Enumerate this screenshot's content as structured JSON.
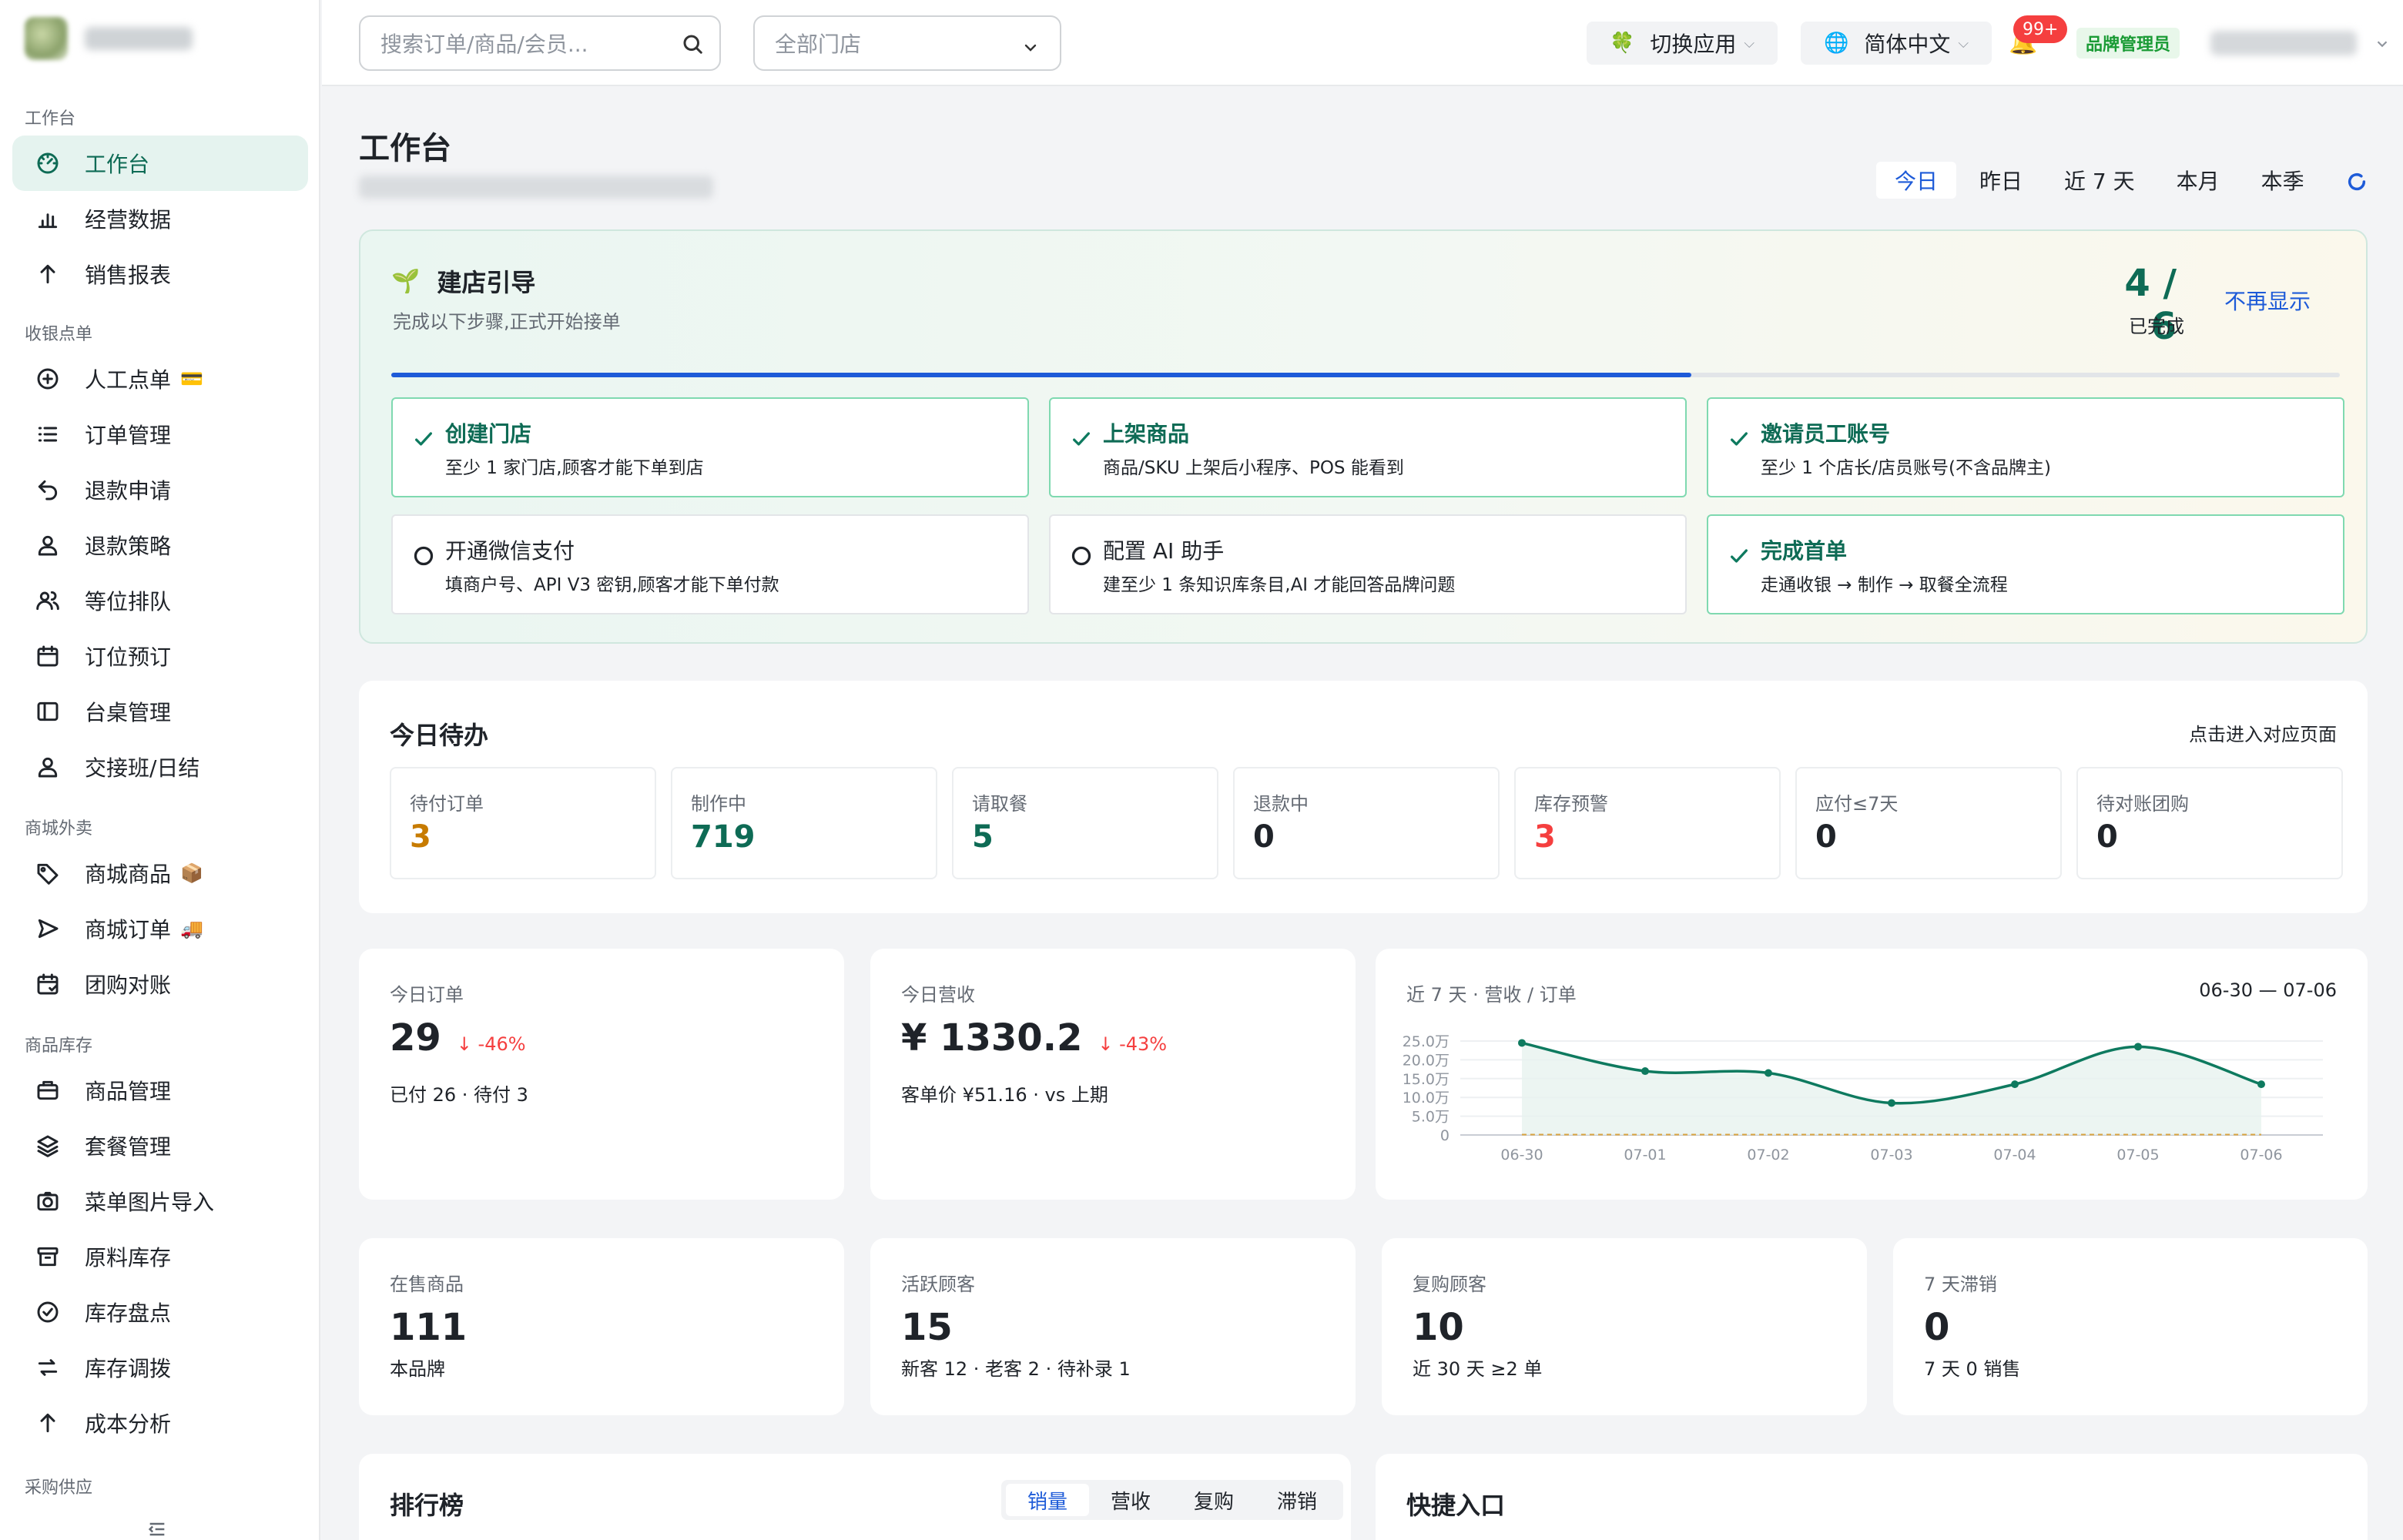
{
  "sidebar": {
    "groups": [
      {
        "label": "工作台"
      },
      {
        "label": "收银点单"
      },
      {
        "label": "商城外卖"
      },
      {
        "label": "商品库存"
      },
      {
        "label": "采购供应"
      }
    ],
    "items": [
      {
        "label": "工作台",
        "icon": "dashboard-icon",
        "active": true
      },
      {
        "label": "经营数据",
        "icon": "bar-chart-icon"
      },
      {
        "label": "销售报表",
        "icon": "arrow-up-icon"
      },
      {
        "label": "人工点单",
        "icon": "plus-circle-icon",
        "emoji": "💳"
      },
      {
        "label": "订单管理",
        "icon": "list-icon"
      },
      {
        "label": "退款申请",
        "icon": "undo-icon"
      },
      {
        "label": "退款策略",
        "icon": "user-icon"
      },
      {
        "label": "等位排队",
        "icon": "users-icon"
      },
      {
        "label": "订位预订",
        "icon": "calendar-icon"
      },
      {
        "label": "台桌管理",
        "icon": "table-icon"
      },
      {
        "label": "交接班/日结",
        "icon": "user-icon"
      },
      {
        "label": "商城商品",
        "icon": "tag-icon",
        "emoji": "📦"
      },
      {
        "label": "商城订单",
        "icon": "send-icon",
        "emoji": "🚚"
      },
      {
        "label": "团购对账",
        "icon": "calendar-check-icon"
      },
      {
        "label": "商品管理",
        "icon": "briefcase-icon"
      },
      {
        "label": "套餐管理",
        "icon": "layers-icon"
      },
      {
        "label": "菜单图片导入",
        "icon": "camera-icon"
      },
      {
        "label": "原料库存",
        "icon": "archive-icon"
      },
      {
        "label": "库存盘点",
        "icon": "check-circle-icon"
      },
      {
        "label": "库存调拨",
        "icon": "swap-icon"
      },
      {
        "label": "成本分析",
        "icon": "arrow-up-icon"
      }
    ]
  },
  "topbar": {
    "search_placeholder": "搜索订单/商品/会员...",
    "store_select": "全部门店",
    "switch_app": "切换应用",
    "language": "简体中文",
    "notification_count": "99+",
    "role": "品牌管理员"
  },
  "page": {
    "title": "工作台",
    "ranges": [
      "今日",
      "昨日",
      "近 7 天",
      "本月",
      "本季"
    ],
    "active_range": 0
  },
  "guide": {
    "title": "建店引导",
    "subtitle": "完成以下步骤,正式开始接单",
    "count": "4 / 6",
    "count_label": "已完成",
    "dismiss": "不再显示",
    "progress": 0.667,
    "steps": [
      {
        "title": "创建门店",
        "desc": "至少 1 家门店,顾客才能下单到店",
        "done": true
      },
      {
        "title": "上架商品",
        "desc": "商品/SKU 上架后小程序、POS 能看到",
        "done": true
      },
      {
        "title": "邀请员工账号",
        "desc": "至少 1 个店长/店员账号(不含品牌主)",
        "done": true
      },
      {
        "title": "开通微信支付",
        "desc": "填商户号、API V3 密钥,顾客才能下单付款",
        "done": false
      },
      {
        "title": "配置 AI 助手",
        "desc": "建至少 1 条知识库条目,AI 才能回答品牌问题",
        "done": false
      },
      {
        "title": "完成首单",
        "desc": "走通收银 → 制作 → 取餐全流程",
        "done": true
      }
    ]
  },
  "todo": {
    "title": "今日待办",
    "link": "点击进入对应页面",
    "items": [
      {
        "label": "待付订单",
        "value": "3",
        "color": "#c77b00"
      },
      {
        "label": "制作中",
        "value": "719",
        "color": "#0e6b55"
      },
      {
        "label": "请取餐",
        "value": "5",
        "color": "#0e6b55"
      },
      {
        "label": "退款中",
        "value": "0",
        "color": "#1f2329"
      },
      {
        "label": "库存预警",
        "value": "3",
        "color": "#f53f3f"
      },
      {
        "label": "应付≤7天",
        "value": "0",
        "color": "#1f2329"
      },
      {
        "label": "待对账团购",
        "value": "0",
        "color": "#1f2329"
      }
    ]
  },
  "kpis": [
    {
      "label": "今日订单",
      "value": "29",
      "delta": "↓ -46%",
      "sub": "已付 26 · 待付 3"
    },
    {
      "label": "今日营收",
      "value": "¥ 1330.2",
      "delta": "↓ -43%",
      "sub": "客单价 ¥51.16 · vs 上期"
    },
    {
      "label": "在售商品",
      "value": "111",
      "delta": "",
      "sub": "本品牌"
    },
    {
      "label": "活跃顾客",
      "value": "15",
      "delta": "",
      "sub": "新客 12 · 老客 2 · 待补录 1"
    },
    {
      "label": "复购顾客",
      "value": "10",
      "delta": "",
      "sub": "近 30 天 ≥2 单"
    },
    {
      "label": "7 天滞销",
      "value": "0",
      "delta": "",
      "sub": "7 天 0 销售"
    }
  ],
  "chart_data": {
    "type": "line",
    "title": "近 7 天 · 营收 / 订单",
    "range_label": "06-30 — 07-06",
    "x": [
      "06-30",
      "07-01",
      "07-02",
      "07-03",
      "07-04",
      "07-05",
      "07-06"
    ],
    "y_ticks": [
      "0",
      "5.0万",
      "10.0万",
      "15.0万",
      "20.0万",
      "25.0万"
    ],
    "ylim": [
      0,
      25
    ],
    "series": [
      {
        "values": [
          24.5,
          17.0,
          16.5,
          8.5,
          13.5,
          23.5,
          13.5
        ],
        "color": "#0e7a5f"
      },
      {
        "values": [
          0.1,
          0.1,
          0.1,
          0.1,
          0.1,
          0.1,
          0.1
        ],
        "color": "#d9a441"
      }
    ]
  },
  "ranking": {
    "title": "排行榜",
    "tabs": [
      "销量",
      "营收",
      "复购",
      "滞销"
    ],
    "active_tab": 0
  },
  "quick": {
    "title": "快捷入口"
  }
}
